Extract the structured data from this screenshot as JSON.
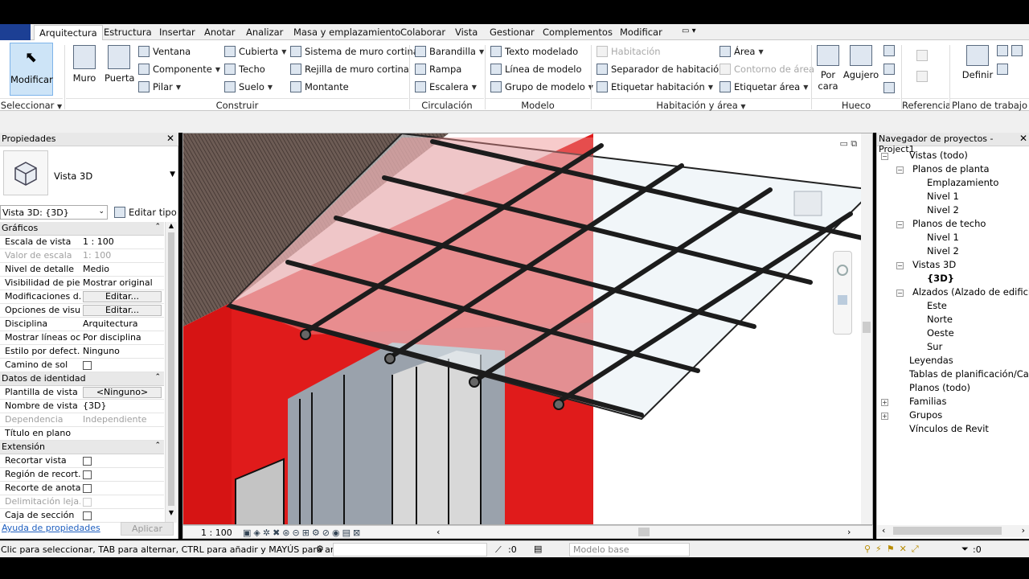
{
  "tabs": [
    {
      "label": "Arquitectura",
      "active": true
    },
    {
      "label": "Estructura"
    },
    {
      "label": "Insertar"
    },
    {
      "label": "Anotar"
    },
    {
      "label": "Analizar"
    },
    {
      "label": "Masa y emplazamiento"
    },
    {
      "label": "Colaborar"
    },
    {
      "label": "Vista"
    },
    {
      "label": "Gestionar"
    },
    {
      "label": "Complementos"
    },
    {
      "label": "Modificar"
    }
  ],
  "ribbon": {
    "modify": "Modificar",
    "wall": "Muro",
    "door": "Puerta",
    "window": "Ventana",
    "component": "Componente",
    "column": "Pilar",
    "roof": "Cubierta",
    "ceiling": "Techo",
    "floor": "Suelo",
    "curtain_system": "Sistema de muro cortina",
    "curtain_grid": "Rejilla de muro cortina",
    "mullion": "Montante",
    "railing": "Barandilla",
    "ramp": "Rampa",
    "stair": "Escalera",
    "model_text": "Texto modelado",
    "model_line": "Línea de modelo",
    "model_group": "Grupo de modelo",
    "room": "Habitación",
    "room_separator": "Separador de habitación",
    "tag_room": "Etiquetar habitación",
    "area": "Área",
    "area_boundary": "Contorno de área",
    "tag_area": "Etiquetar área",
    "by_face_1": "Por",
    "by_face_2": "cara",
    "opening": "Agujero",
    "set": "Definir",
    "panels": {
      "select": "Seleccionar",
      "build": "Construir",
      "circulation": "Circulación",
      "model": "Modelo",
      "room_area": "Habitación y área",
      "opening": "Hueco",
      "datum": "Referencia",
      "work_plane": "Plano de trabajo"
    }
  },
  "properties": {
    "title": "Propiedades",
    "type_name": "Vista 3D",
    "instance_select": "Vista 3D: {3D}",
    "edit_type": "Editar tipo",
    "sections": {
      "graphics": "Gráficos",
      "identity": "Datos de identidad",
      "extents": "Extensión"
    },
    "graphics_rows": [
      {
        "k": "Escala de vista",
        "v": "1 : 100"
      },
      {
        "k": "Valor de escala",
        "v": "1:   100",
        "dis": true
      },
      {
        "k": "Nivel de detalle",
        "v": "Medio"
      },
      {
        "k": "Visibilidad de pie...",
        "v": "Mostrar original"
      },
      {
        "k": "Modificaciones d...",
        "v": "Editar..."
      },
      {
        "k": "Opciones de visu...",
        "v": "Editar..."
      },
      {
        "k": "Disciplina",
        "v": "Arquitectura"
      },
      {
        "k": "Mostrar líneas oc...",
        "v": "Por disciplina"
      },
      {
        "k": "Estilo por defect...",
        "v": "Ninguno"
      },
      {
        "k": "Camino de sol",
        "v": ""
      }
    ],
    "identity_rows": [
      {
        "k": "Plantilla de vista",
        "v": "<Ninguno>"
      },
      {
        "k": "Nombre de vista",
        "v": "{3D}"
      },
      {
        "k": "Dependencia",
        "v": "Independiente",
        "dis": true
      },
      {
        "k": "Título en plano",
        "v": ""
      }
    ],
    "extent_rows": [
      {
        "k": "Recortar vista"
      },
      {
        "k": "Región de recort..."
      },
      {
        "k": "Recorte de anota..."
      },
      {
        "k": "Delimitación leja...",
        "dis": true
      },
      {
        "k": "Caja de sección"
      }
    ],
    "help": "Ayuda de propiedades",
    "apply": "Aplicar"
  },
  "viewport": {
    "scale": "1 : 100"
  },
  "browser": {
    "title": "Navegador de proyectos - Project1",
    "nodes": [
      {
        "label": "Vistas (todo)"
      },
      {
        "label": "Planos de planta"
      },
      {
        "label": "Emplazamiento"
      },
      {
        "label": "Nivel 1"
      },
      {
        "label": "Nivel 2"
      },
      {
        "label": "Planos de techo"
      },
      {
        "label": "Nivel 1"
      },
      {
        "label": "Nivel 2"
      },
      {
        "label": "Vistas 3D"
      },
      {
        "label": "{3D}"
      },
      {
        "label": "Alzados (Alzado de edificio)"
      },
      {
        "label": "Este"
      },
      {
        "label": "Norte"
      },
      {
        "label": "Oeste"
      },
      {
        "label": "Sur"
      },
      {
        "label": "Leyendas"
      },
      {
        "label": "Tablas de planificación/Cantidades"
      },
      {
        "label": "Planos (todo)"
      },
      {
        "label": "Familias"
      },
      {
        "label": "Grupos"
      },
      {
        "label": "Vínculos de Revit"
      }
    ]
  },
  "status": {
    "message": "Clic para seleccionar, TAB para alternar, CTRL para añadir y MAYÚS para anular",
    "zero": ":0",
    "model": "Modelo base",
    "filter": ":0"
  }
}
